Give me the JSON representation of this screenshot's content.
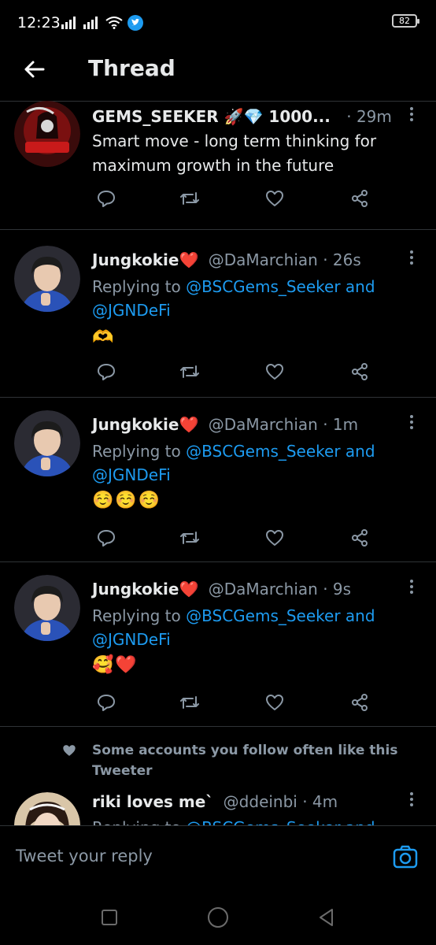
{
  "status": {
    "time": "12:23",
    "battery": "82"
  },
  "header": {
    "title": "Thread"
  },
  "tweets": [
    {
      "name": "GEMS_SEEKER 🚀💎 1000...",
      "meta": "· 29m",
      "text": "Smart move - long term thinking for maximum growth in the future"
    },
    {
      "name": "Jungkokie❤️",
      "meta": "@DaMarchian · 26s",
      "replying_prefix": "Replying to ",
      "replying_users": "@BSCGems_Seeker and @JGNDeFi",
      "emoji": "🫶"
    },
    {
      "name": "Jungkokie❤️",
      "meta": "@DaMarchian · 1m",
      "replying_prefix": "Replying to ",
      "replying_users": "@BSCGems_Seeker and @JGNDeFi",
      "emoji": "☺️☺️☺️"
    },
    {
      "name": "Jungkokie❤️",
      "meta": "@DaMarchian · 9s",
      "replying_prefix": "Replying to ",
      "replying_users": "@BSCGems_Seeker and @JGNDeFi",
      "emoji": "🥰❤️"
    },
    {
      "name": "riki loves me`",
      "meta": "@ddeinbi · 4m",
      "replying_prefix": "Replying to ",
      "replying_users": "@BSCGems_Seeker and"
    }
  ],
  "social_context": "Some accounts you follow often like this Tweeter",
  "composer": {
    "placeholder": "Tweet your reply"
  },
  "icons": {
    "back": "arrow-left-icon",
    "reply": "reply-icon",
    "retweet": "retweet-icon",
    "like": "heart-icon",
    "share": "share-icon",
    "camera": "camera-icon"
  },
  "colors": {
    "accent": "#1d9bf0",
    "muted": "#8b98a5",
    "background": "#000000"
  }
}
